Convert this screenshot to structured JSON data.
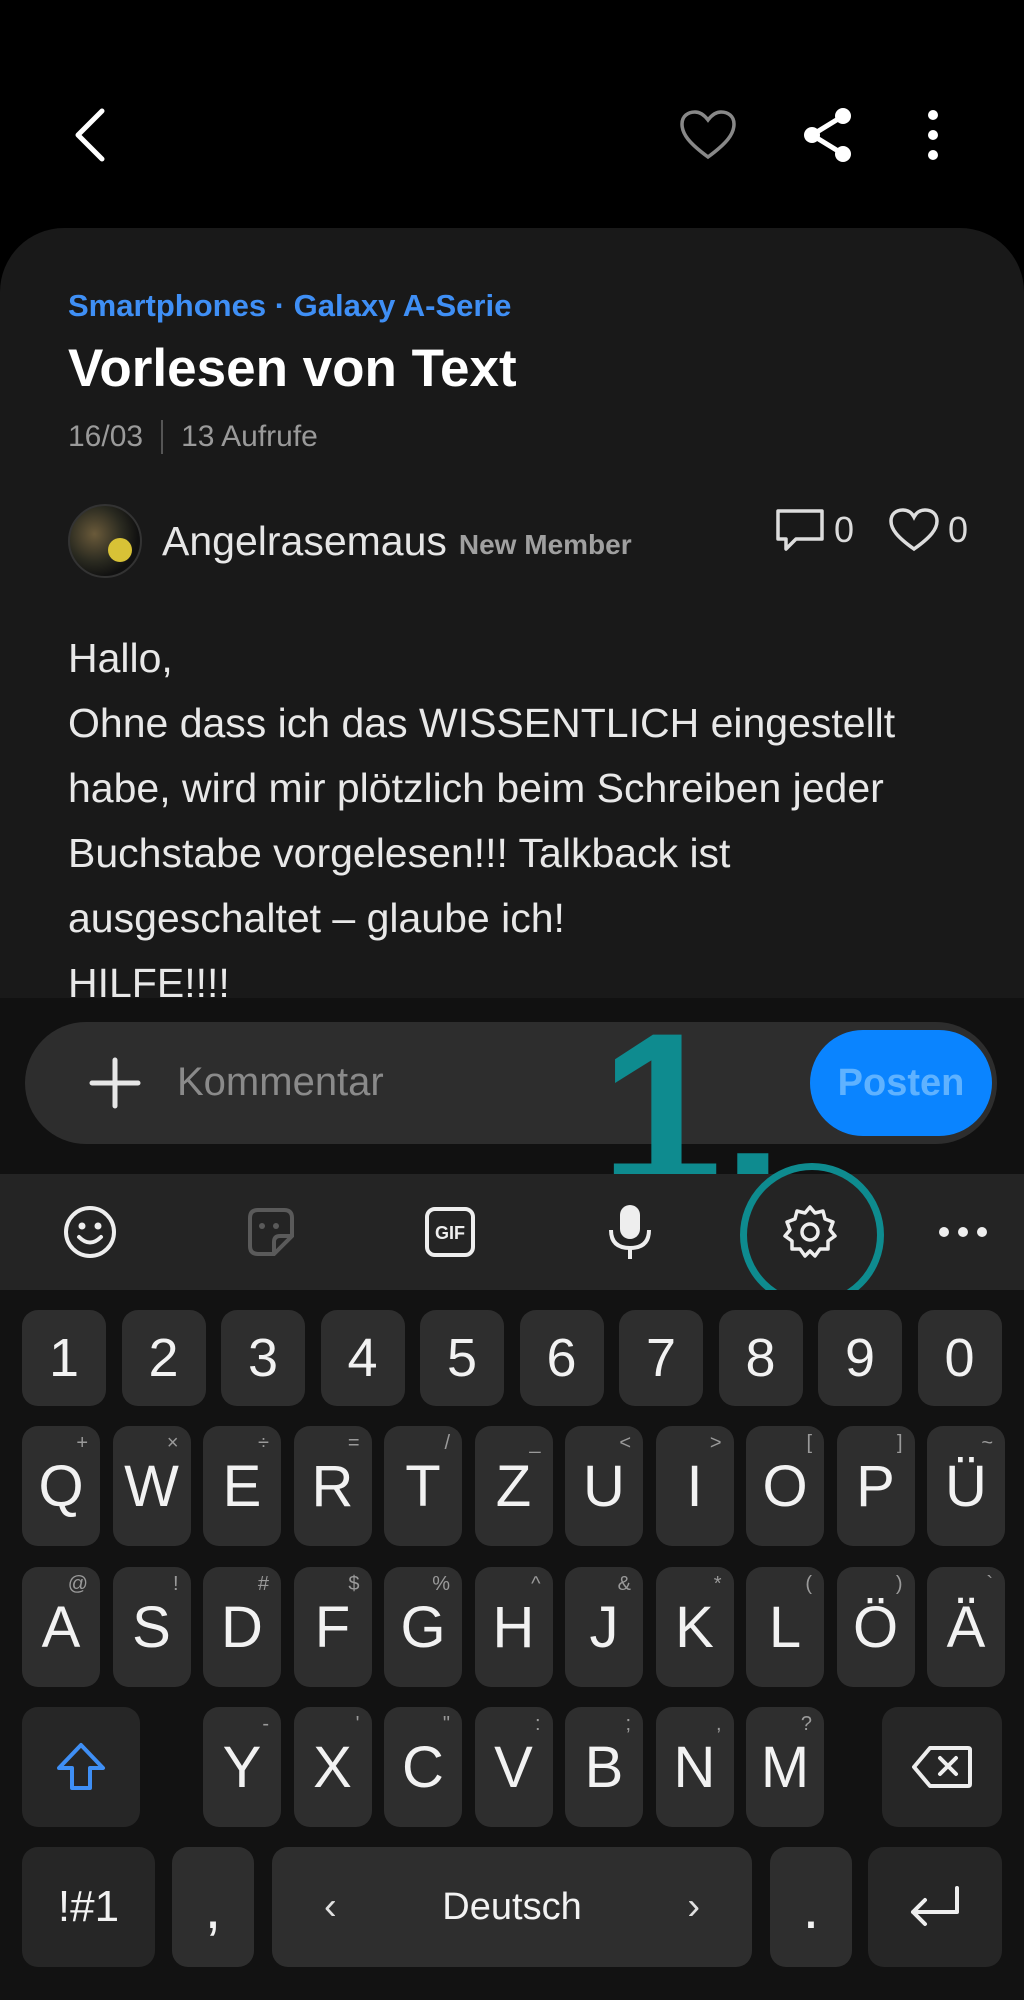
{
  "header": {
    "back_icon": "chevron-left-icon",
    "favorite_icon": "heart-outline-icon",
    "share_icon": "share-icon",
    "more_icon": "more-vertical-icon"
  },
  "post": {
    "breadcrumb": "Smartphones · Galaxy A-Serie",
    "title": "Vorlesen von Text",
    "date": "16/03",
    "views": "13 Aufrufe",
    "author": "Angelrasemaus",
    "author_badge": "New Member",
    "comments_count": "0",
    "likes_count": "0",
    "body_lines": [
      "Hallo,",
      "Ohne dass ich das WISSENTLICH eingestellt",
      "habe, wird mir plötzlich beim Schreiben jeder",
      "Buchstabe vorgelesen!!! Talkback ist",
      "ausgeschaltet – glaube ich!",
      "HILFE!!!!"
    ]
  },
  "composer": {
    "placeholder": "Kommentar",
    "post_label": "Posten"
  },
  "annotation": {
    "number_label": "1.",
    "color": "#0e8b8f"
  },
  "keyboard_toolbar": {
    "gif_label": "GIF",
    "items": [
      "emoji-icon",
      "sticker-icon",
      "gif-icon",
      "microphone-icon",
      "settings-gear-icon",
      "more-horizontal-icon"
    ]
  },
  "keyboard": {
    "number_row": [
      "1",
      "2",
      "3",
      "4",
      "5",
      "6",
      "7",
      "8",
      "9",
      "0"
    ],
    "row1": [
      {
        "k": "Q",
        "h": "+"
      },
      {
        "k": "W",
        "h": "×"
      },
      {
        "k": "E",
        "h": "÷"
      },
      {
        "k": "R",
        "h": "="
      },
      {
        "k": "T",
        "h": "/"
      },
      {
        "k": "Z",
        "h": "_"
      },
      {
        "k": "U",
        "h": "<"
      },
      {
        "k": "I",
        "h": ">"
      },
      {
        "k": "O",
        "h": "["
      },
      {
        "k": "P",
        "h": "]"
      },
      {
        "k": "Ü",
        "h": "~"
      }
    ],
    "row2": [
      {
        "k": "A",
        "h": "@"
      },
      {
        "k": "S",
        "h": "!"
      },
      {
        "k": "D",
        "h": "#"
      },
      {
        "k": "F",
        "h": "$"
      },
      {
        "k": "G",
        "h": "%"
      },
      {
        "k": "H",
        "h": "^"
      },
      {
        "k": "J",
        "h": "&"
      },
      {
        "k": "K",
        "h": "*"
      },
      {
        "k": "L",
        "h": "("
      },
      {
        "k": "Ö",
        "h": ")"
      },
      {
        "k": "Ä",
        "h": "`"
      }
    ],
    "row3": [
      {
        "k": "Y",
        "h": "-"
      },
      {
        "k": "X",
        "h": "'"
      },
      {
        "k": "C",
        "h": "\""
      },
      {
        "k": "V",
        "h": ":"
      },
      {
        "k": "B",
        "h": ";"
      },
      {
        "k": "N",
        "h": ","
      },
      {
        "k": "M",
        "h": "?"
      }
    ],
    "symbols_label": "!#1",
    "comma_label": ",",
    "space_label": "Deutsch",
    "space_left": "‹",
    "space_right": "›",
    "period_label": ".",
    "accent_color": "#3f8ff5"
  }
}
